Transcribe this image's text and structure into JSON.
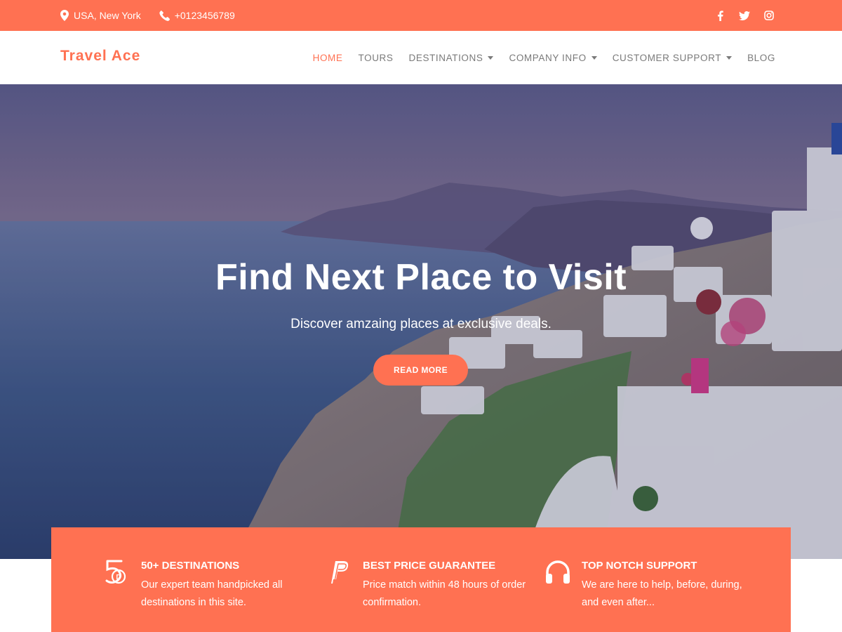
{
  "topbar": {
    "location": "USA, New York",
    "phone": "+0123456789",
    "location_icon": "map-pin-icon",
    "phone_icon": "phone-icon",
    "social": [
      "facebook-icon",
      "twitter-icon",
      "instagram-icon"
    ]
  },
  "header": {
    "brand": "Travel Ace",
    "nav": [
      {
        "label": "HOME",
        "active": true,
        "dropdown": false
      },
      {
        "label": "TOURS",
        "active": false,
        "dropdown": false
      },
      {
        "label": "DESTINATIONS",
        "active": false,
        "dropdown": true
      },
      {
        "label": "COMPANY INFO",
        "active": false,
        "dropdown": true
      },
      {
        "label": "CUSTOMER SUPPORT",
        "active": false,
        "dropdown": true
      },
      {
        "label": "BLOG",
        "active": false,
        "dropdown": false
      }
    ]
  },
  "hero": {
    "title": "Find Next Place to Visit",
    "subtitle": "Discover amzaing places at exclusive deals.",
    "button": "READ MORE"
  },
  "features": [
    {
      "icon": "fifty-badge-icon",
      "title": "50+ DESTINATIONS",
      "description": "Our expert team handpicked all destinations in this site."
    },
    {
      "icon": "paypal-icon",
      "title": "BEST PRICE GUARANTEE",
      "description": "Price match within 48 hours of order confirmation."
    },
    {
      "icon": "headphones-icon",
      "title": "TOP NOTCH SUPPORT",
      "description": "We are here to help, before, during, and even after..."
    }
  ],
  "colors": {
    "accent": "#ff7152",
    "nav_text": "#7a7a7a",
    "white": "#ffffff"
  }
}
